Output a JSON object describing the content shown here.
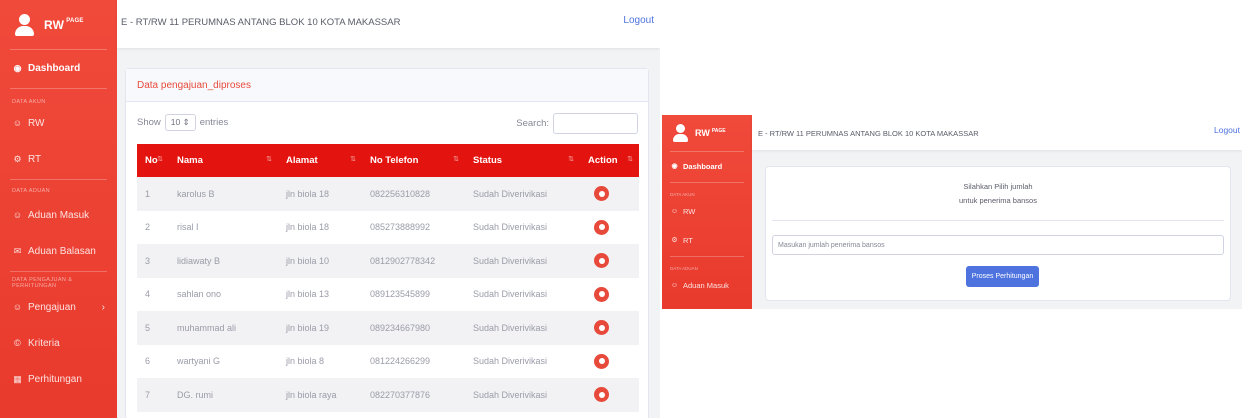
{
  "colors": {
    "sidebar": "#e83a2d",
    "table_header": "#e3140f",
    "primary": "#4e73df",
    "action": "#e74a3b"
  },
  "panel1": {
    "brand": {
      "name": "RW",
      "suffix": "PAGE"
    },
    "header": {
      "title": "E - RT/RW 11 PERUMNAS ANTANG BLOK 10 KOTA MAKASSAR",
      "logout": "Logout"
    },
    "sidebar": {
      "dashboard": "Dashboard",
      "heading_data_akun": "DATA AKUN",
      "rw": "RW",
      "rt": "RT",
      "heading_data_aduan": "DATA ADUAN",
      "aduan_masuk": "Aduan Masuk",
      "aduan_balasan": "Aduan Balasan",
      "heading_pengajuan": "DATA PENGAJUAN & PERHITUNGAN",
      "pengajuan": "Pengajuan",
      "kriteria": "Kriteria",
      "perhitungan": "Perhitungan"
    },
    "card": {
      "title": "Data pengajuan_diproses",
      "show_label": "Show",
      "entries_value": "10",
      "entries_label": "entries",
      "search_label": "Search:"
    },
    "table": {
      "headers": [
        "No",
        "Nama",
        "Alamat",
        "No Telefon",
        "Status",
        "Action"
      ],
      "rows": [
        {
          "no": "1",
          "nama": "karolus B",
          "alamat": "jln biola 18",
          "telp": "082256310828",
          "status": "Sudah Diverivikasi"
        },
        {
          "no": "2",
          "nama": "risal I",
          "alamat": "jln biola 18",
          "telp": "085273888992",
          "status": "Sudah Diverivikasi"
        },
        {
          "no": "3",
          "nama": "lidiawaty B",
          "alamat": "jln biola 10",
          "telp": "0812902778342",
          "status": "Sudah Diverivikasi"
        },
        {
          "no": "4",
          "nama": "sahlan ono",
          "alamat": "jln biola 13",
          "telp": "089123545899",
          "status": "Sudah Diverivikasi"
        },
        {
          "no": "5",
          "nama": "muhammad ali",
          "alamat": "jln biola 19",
          "telp": "089234667980",
          "status": "Sudah Diverivikasi"
        },
        {
          "no": "6",
          "nama": "wartyani G",
          "alamat": "jln biola 8",
          "telp": "081224266299",
          "status": "Sudah Diverivikasi"
        },
        {
          "no": "7",
          "nama": "DG. rumi",
          "alamat": "jln biola raya",
          "telp": "082270377876",
          "status": "Sudah Diverivikasi"
        }
      ]
    }
  },
  "panel2": {
    "brand": {
      "name": "RW",
      "suffix": "PAGE"
    },
    "header": {
      "title": "E - RT/RW 11 PERUMNAS ANTANG BLOK 10 KOTA MAKASSAR",
      "logout": "Logout"
    },
    "sidebar": {
      "dashboard": "Dashboard",
      "heading_data_akun": "DATA AKUN",
      "rw": "RW",
      "rt": "RT",
      "heading_data_aduan": "DATA ADUAN",
      "aduan_masuk": "Aduan Masuk"
    },
    "card": {
      "line1": "Silahkan Pilih jumlah",
      "line2": "untuk penerima bansos",
      "placeholder": "Masukan jumlah penerima bansos",
      "button": "Proses Perhitungan"
    }
  }
}
